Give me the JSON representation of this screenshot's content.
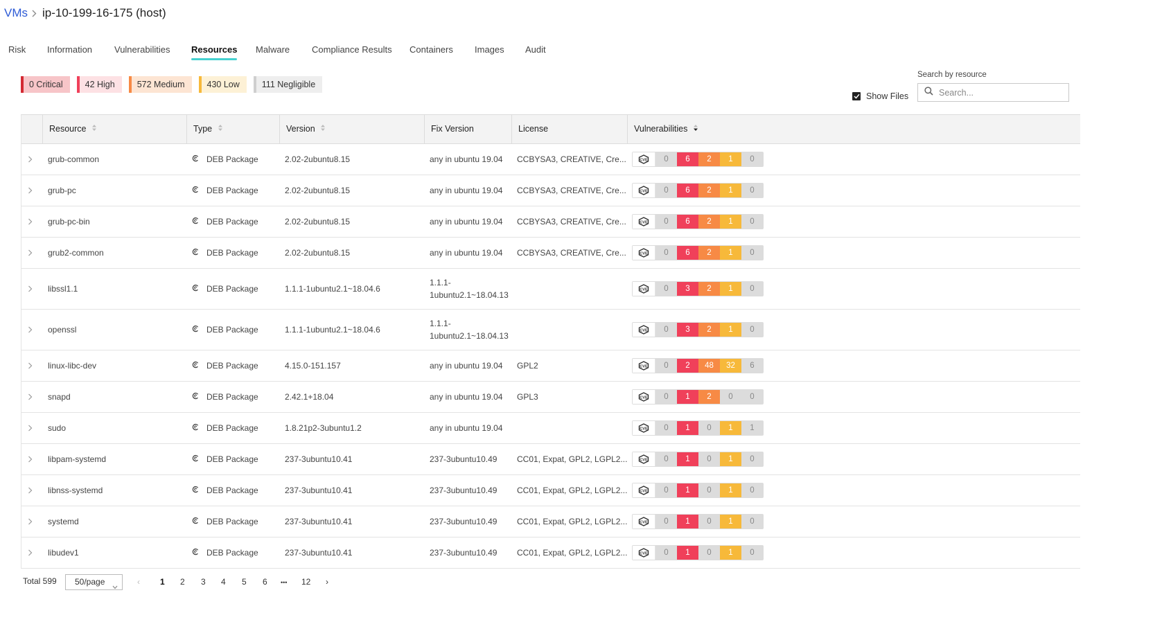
{
  "breadcrumb": {
    "parent": "VMs",
    "current": "ip-10-199-16-175 (host)"
  },
  "tabs": [
    "Risk",
    "Information",
    "Vulnerabilities",
    "Resources",
    "Malware",
    "Compliance Results",
    "Containers",
    "Images",
    "Audit"
  ],
  "active_tab": "Resources",
  "severity_badges": [
    {
      "label": "0 Critical",
      "bg": "#f7c5c8",
      "border": "#d32a32"
    },
    {
      "label": "42 High",
      "bg": "#fde1e4",
      "border": "#f0405a"
    },
    {
      "label": "572 Medium",
      "bg": "#fde5d3",
      "border": "#f78a45"
    },
    {
      "label": "430 Low",
      "bg": "#fdf1d6",
      "border": "#f7b93a"
    },
    {
      "label": "111 Negligible",
      "bg": "#eeeeee",
      "border": "#cfcfcf"
    }
  ],
  "search": {
    "label": "Search by resource",
    "placeholder": "Search..."
  },
  "show_files": {
    "label": "Show Files",
    "checked": true
  },
  "table": {
    "columns": [
      "Resource",
      "Type",
      "Version",
      "Fix Version",
      "License",
      "Vulnerabilities"
    ],
    "rows": [
      {
        "resource": "grub-common",
        "type": "DEB Package",
        "version": "2.02-2ubuntu8.15",
        "fix_version": "any in ubuntu 19.04",
        "license": "CCBYSA3, CREATIVE, Cre...",
        "vulns": [
          0,
          6,
          2,
          1,
          0
        ]
      },
      {
        "resource": "grub-pc",
        "type": "DEB Package",
        "version": "2.02-2ubuntu8.15",
        "fix_version": "any in ubuntu 19.04",
        "license": "CCBYSA3, CREATIVE, Cre...",
        "vulns": [
          0,
          6,
          2,
          1,
          0
        ]
      },
      {
        "resource": "grub-pc-bin",
        "type": "DEB Package",
        "version": "2.02-2ubuntu8.15",
        "fix_version": "any in ubuntu 19.04",
        "license": "CCBYSA3, CREATIVE, Cre...",
        "vulns": [
          0,
          6,
          2,
          1,
          0
        ]
      },
      {
        "resource": "grub2-common",
        "type": "DEB Package",
        "version": "2.02-2ubuntu8.15",
        "fix_version": "any in ubuntu 19.04",
        "license": "CCBYSA3, CREATIVE, Cre...",
        "vulns": [
          0,
          6,
          2,
          1,
          0
        ]
      },
      {
        "resource": "libssl1.1",
        "type": "DEB Package",
        "version": "1.1.1-1ubuntu2.1~18.04.6",
        "fix_version": "1.1.1-1ubuntu2.1~18.04.13",
        "license": "",
        "vulns": [
          0,
          3,
          2,
          1,
          0
        ]
      },
      {
        "resource": "openssl",
        "type": "DEB Package",
        "version": "1.1.1-1ubuntu2.1~18.04.6",
        "fix_version": "1.1.1-1ubuntu2.1~18.04.13",
        "license": "",
        "vulns": [
          0,
          3,
          2,
          1,
          0
        ]
      },
      {
        "resource": "linux-libc-dev",
        "type": "DEB Package",
        "version": "4.15.0-151.157",
        "fix_version": "any in ubuntu 19.04",
        "license": "GPL2",
        "vulns": [
          0,
          2,
          48,
          32,
          6
        ]
      },
      {
        "resource": "snapd",
        "type": "DEB Package",
        "version": "2.42.1+18.04",
        "fix_version": "any in ubuntu 19.04",
        "license": "GPL3",
        "vulns": [
          0,
          1,
          2,
          0,
          0
        ]
      },
      {
        "resource": "sudo",
        "type": "DEB Package",
        "version": "1.8.21p2-3ubuntu1.2",
        "fix_version": "any in ubuntu 19.04",
        "license": "",
        "vulns": [
          0,
          1,
          0,
          1,
          1
        ]
      },
      {
        "resource": "libpam-systemd",
        "type": "DEB Package",
        "version": "237-3ubuntu10.41",
        "fix_version": "237-3ubuntu10.49",
        "license": "CC01, Expat, GPL2, LGPL2...",
        "vulns": [
          0,
          1,
          0,
          1,
          0
        ]
      },
      {
        "resource": "libnss-systemd",
        "type": "DEB Package",
        "version": "237-3ubuntu10.41",
        "fix_version": "237-3ubuntu10.49",
        "license": "CC01, Expat, GPL2, LGPL2...",
        "vulns": [
          0,
          1,
          0,
          1,
          0
        ]
      },
      {
        "resource": "systemd",
        "type": "DEB Package",
        "version": "237-3ubuntu10.41",
        "fix_version": "237-3ubuntu10.49",
        "license": "CC01, Expat, GPL2, LGPL2...",
        "vulns": [
          0,
          1,
          0,
          1,
          0
        ]
      },
      {
        "resource": "libudev1",
        "type": "DEB Package",
        "version": "237-3ubuntu10.41",
        "fix_version": "237-3ubuntu10.49",
        "license": "CC01, Expat, GPL2, LGPL2...",
        "vulns": [
          0,
          1,
          0,
          1,
          0
        ]
      }
    ]
  },
  "vuln_colors": {
    "critical": "#d32a32",
    "high": "#f0405a",
    "medium": "#f78a45",
    "low": "#f7b93a",
    "negligible": "#dcdcdc",
    "zero": "#dcdcdc"
  },
  "icons": {
    "type": "debian-icon",
    "vulns": "cve-icon",
    "expand": "chevron-right-icon",
    "search": "search-icon",
    "sort": "sort-icon"
  },
  "pagination": {
    "total": "Total 599",
    "page_size": "50/page",
    "pages": [
      "1",
      "2",
      "3",
      "4",
      "5",
      "6",
      "•••",
      "12"
    ],
    "active_page": "1",
    "prev": "‹",
    "next": "›"
  }
}
